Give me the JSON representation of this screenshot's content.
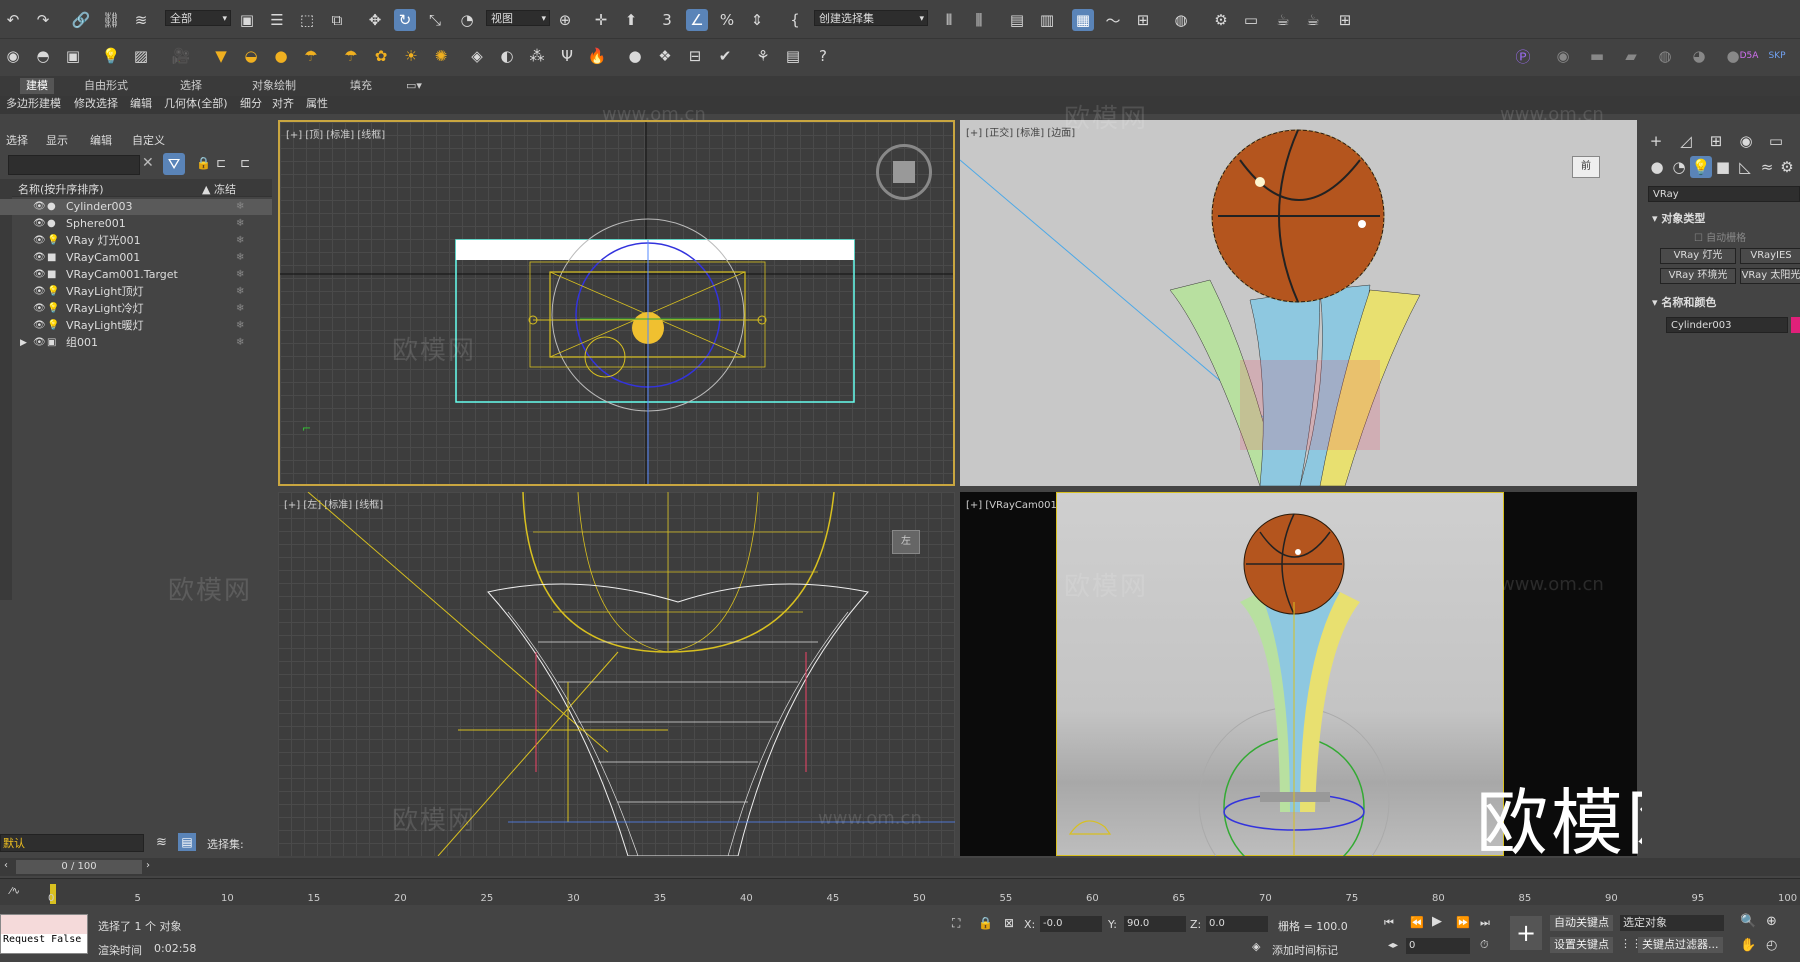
{
  "toolbar1": {
    "selection_filter": "全部",
    "ref_coord": "视图",
    "named_selection": "创建选择集"
  },
  "ribbon_tabs": [
    "建模",
    "自由形式",
    "选择",
    "对象绘制",
    "填充"
  ],
  "ribbon_sub": [
    "多边形建模",
    "修改选择",
    "编辑",
    "几何体(全部)",
    "细分",
    "对齐",
    "属性"
  ],
  "scene_explorer": {
    "menu": [
      "选择",
      "显示",
      "编辑",
      "自定义"
    ],
    "col_name": "名称(按升序排序)",
    "col_freeze": "▲ 冻结",
    "items": [
      {
        "name": "Cylinder003",
        "icon": "sphere-icon"
      },
      {
        "name": "Sphere001",
        "icon": "sphere-icon"
      },
      {
        "name": "VRay 灯光001",
        "icon": "light-icon"
      },
      {
        "name": "VRayCam001",
        "icon": "camera-icon"
      },
      {
        "name": "VRayCam001.Target",
        "icon": "camera-icon"
      },
      {
        "name": "VRayLight顶灯",
        "icon": "light-icon"
      },
      {
        "name": "VRayLight冷灯",
        "icon": "light-icon"
      },
      {
        "name": "VRayLight暖灯",
        "icon": "light-icon"
      },
      {
        "name": "组001",
        "icon": "group-icon"
      }
    ],
    "layer_value": "默认",
    "selection_set_label": "选择集:"
  },
  "viewports": {
    "top": "[+] [顶] [标准] [线框]",
    "front": "[+] [正交] [标准] [边面]",
    "left": "[+] [左] [标准] [线框]",
    "camera": "[+] [VRayCam001] [标准] [默认明暗处理]",
    "front_cube": "前",
    "left_cube": "左"
  },
  "right_panel": {
    "renderer": "VRay",
    "rollout1": "对象类型",
    "auto_grid": "自动栅格",
    "buttons": [
      "VRay 灯光",
      "VRayIES",
      "VRay 环境光",
      "VRay 太阳光"
    ],
    "rollout2": "名称和颜色",
    "object_name": "Cylinder003",
    "object_color": "#e0207a"
  },
  "timeline": {
    "frame_slider": "0 / 100",
    "ticks": [
      "0",
      "5",
      "10",
      "15",
      "20",
      "25",
      "30",
      "35",
      "40",
      "45",
      "50",
      "55",
      "60",
      "65",
      "70",
      "75",
      "80",
      "85",
      "90",
      "95",
      "100"
    ]
  },
  "status": {
    "selected": "选择了 1 个 对象",
    "render_time_label": "渲染时间",
    "render_time": "0:02:58",
    "maxscript": "Request False",
    "x_label": "X:",
    "x": "-0.0",
    "y_label": "Y:",
    "y": "90.0",
    "z_label": "Z:",
    "z": "0.0",
    "grid": "栅格 = 100.0",
    "add_time_tag": "添加时间标记",
    "auto_key": "自动关键点",
    "set_key": "设置关键点",
    "selected_object": "选定对象",
    "key_filters": "关键点过滤器...",
    "frame": "0"
  },
  "watermark": {
    "big": "欧模网",
    "small": "欧模网",
    "url": "www.om.cn"
  },
  "colors": {
    "accent": "#5a84b8",
    "selected_border": "#c9a640",
    "wire_yellow": "#d8c020",
    "basketball": "#b4551e"
  }
}
